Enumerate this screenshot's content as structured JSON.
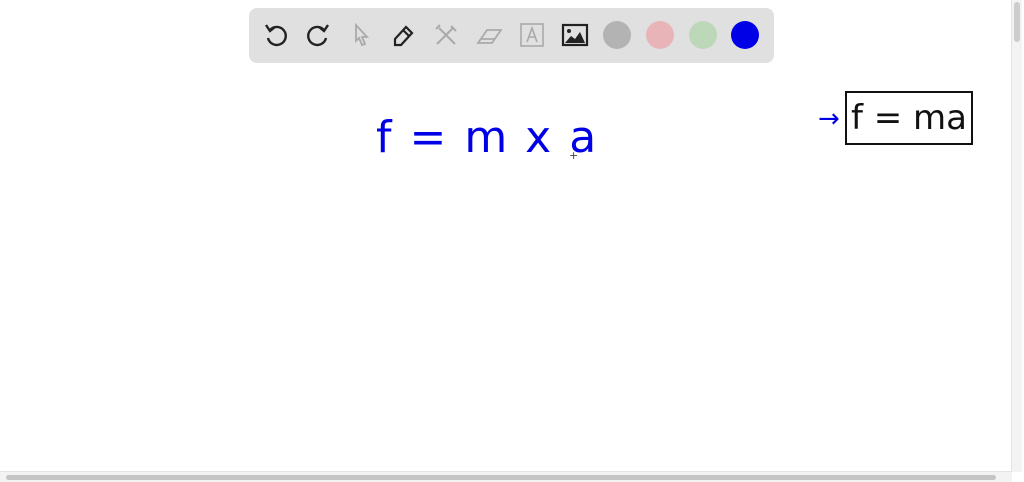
{
  "toolbar": {
    "tools": [
      "undo-icon",
      "redo-icon",
      "select-icon",
      "pen-icon",
      "tools-icon",
      "eraser-icon",
      "text-icon",
      "image-icon"
    ],
    "colors": [
      "#b3b3b3",
      "#e8b4b8",
      "#bcd8b8",
      "#0000e6"
    ],
    "selected_color": "#0000e6"
  },
  "canvas": {
    "formula": "f = m x a",
    "boxed_formula": "f = ma",
    "arrow": "→",
    "cursor": "+"
  }
}
